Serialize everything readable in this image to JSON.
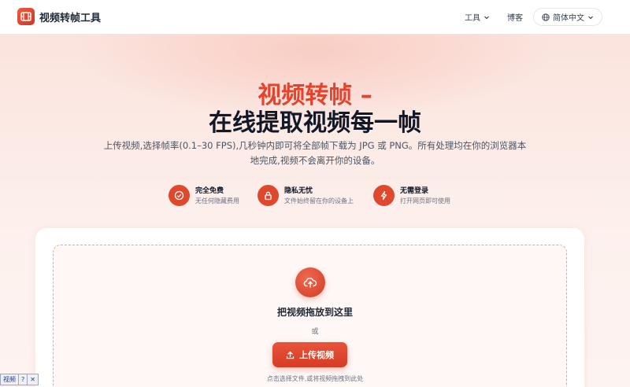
{
  "header": {
    "brand": "视频转帧工具",
    "nav_tools": "工具",
    "nav_blog": "博客",
    "language": "简体中文"
  },
  "hero": {
    "title_line1": "视频转帧 –",
    "title_line2": "在线提取视频每一帧",
    "description": "上传视频,选择帧率(0.1–30 FPS),几秒钟内即可将全部帧下载为 JPG 或 PNG。所有处理均在你的浏览器本地完成,视频不会离开你的设备。"
  },
  "features": [
    {
      "title": "完全免费",
      "subtitle": "无任何隐藏费用",
      "icon": "check-circle-icon"
    },
    {
      "title": "隐私无忧",
      "subtitle": "文件始终留在你的设备上",
      "icon": "lock-icon"
    },
    {
      "title": "无需登录",
      "subtitle": "打开网页即可使用",
      "icon": "lightning-icon"
    }
  ],
  "upload": {
    "drop_title": "把视频拖放到这里",
    "or": "或",
    "button_label": "上传视频",
    "hint": "点击选择文件,或将视频拖拽到此处"
  },
  "ime": {
    "label": "视频",
    "help": "?",
    "close": "✕"
  },
  "colors": {
    "accent": "#e0482e",
    "title_accent": "#e5432c",
    "background": "#fdf1ee"
  }
}
